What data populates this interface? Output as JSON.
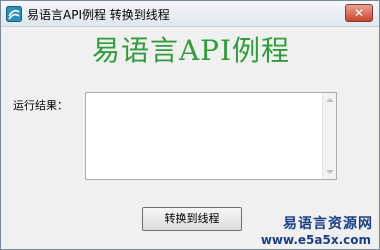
{
  "window": {
    "title": "易语言API例程 转换到线程",
    "close_label": "✕"
  },
  "main": {
    "heading": "易语言API例程",
    "result_label": "运行结果：",
    "result_value": "",
    "convert_button_label": "转换到线程"
  },
  "watermark": {
    "line1": "易语言资源网",
    "line2": "www.e5a5x.com"
  },
  "colors": {
    "heading_green": "#2f9e3a",
    "watermark_blue": "#1a3f8a",
    "close_red": "#c8452d"
  }
}
